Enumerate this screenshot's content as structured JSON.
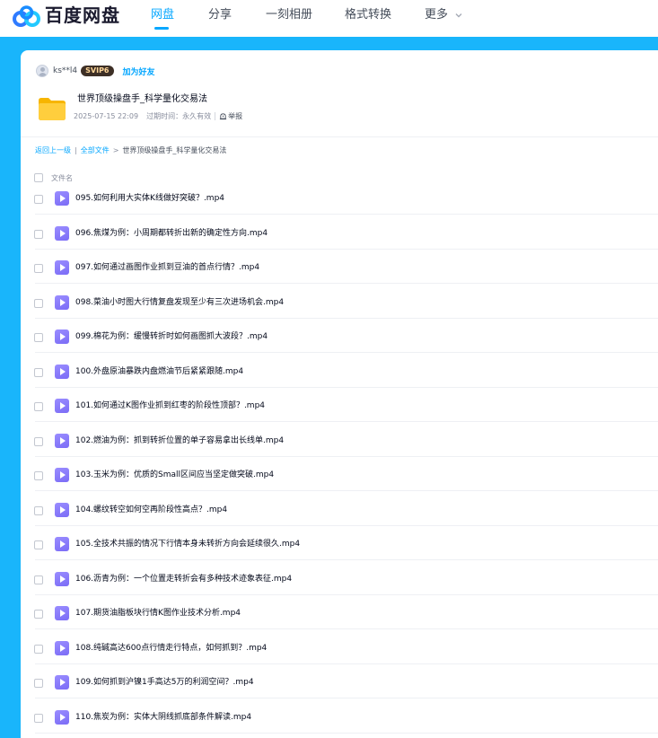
{
  "app": {
    "brand": "百度网盘"
  },
  "nav": [
    {
      "label": "网盘",
      "active": true
    },
    {
      "label": "分享",
      "active": false
    },
    {
      "label": "一刻相册",
      "active": false
    },
    {
      "label": "格式转换",
      "active": false
    },
    {
      "label": "更多",
      "active": false
    }
  ],
  "sharer": {
    "username": "ks**l4",
    "vip_badge": "SVIP6",
    "add_friend": "加为好友"
  },
  "share": {
    "title": "世界顶级操盘手_科学量化交易法",
    "date": "2025-07-15 22:09",
    "expiry": "过期时间：永久有效",
    "report": "举报"
  },
  "breadcrumb": {
    "back": "返回上一级",
    "all_files": "全部文件",
    "separator": ">",
    "current": "世界顶级操盘手_科学量化交易法"
  },
  "list": {
    "header": "文件名",
    "files": [
      "095.如何利用大实体K线做好突破？.mp4",
      "096.焦煤为例：小周期都转折出新的确定性方向.mp4",
      "097.如何通过画图作业抓到豆油的首点行情？.mp4",
      "098.菜油小时图大行情复盘发现至少有三次进场机会.mp4",
      "099.棉花为例：缓慢转折时如何画图抓大波段？.mp4",
      "100.外盘原油暴跌内盘燃油节后紧紧跟随.mp4",
      "101.如何通过K图作业抓到红枣的阶段性顶部？.mp4",
      "102.燃油为例：抓到转折位置的单子容易拿出长线单.mp4",
      "103.玉米为例：优质的Small区间应当坚定做突破.mp4",
      "104.螺纹转空如何空再阶段性高点？.mp4",
      "105.全技术共振的情况下行情本身未转折方向会延续很久.mp4",
      "106.沥青为例：一个位置走转折会有多种技术迹象表征.mp4",
      "107.期货油脂板块行情K图作业技术分析.mp4",
      "108.纯碱高达600点行情走行特点，如何抓到？.mp4",
      "109.如何抓到沪镍1手高达5万的利润空间？.mp4",
      "110.焦炭为例：实体大阴线抓底部条件解读.mp4"
    ]
  },
  "colors": {
    "accent": "#06a7ff",
    "page_background": "#19b5fb",
    "video_icon": "#8b7cf8"
  },
  "icons": [
    "baidu-cloud-logo-icon",
    "chevron-down-icon",
    "avatar-icon",
    "folder-icon",
    "report-icon",
    "checkbox-icon",
    "video-file-icon"
  ]
}
